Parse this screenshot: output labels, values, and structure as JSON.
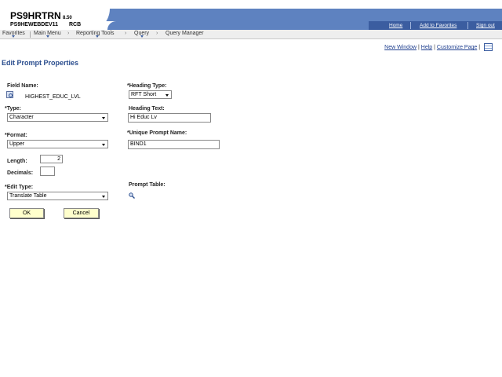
{
  "header": {
    "db_name": "PS9HRTRN",
    "db_version": "8.50",
    "server_name": "PS9HEWEBDEV11",
    "user_id": "RCB",
    "links": [
      "Home",
      "Add to Favorites",
      "Sign out"
    ]
  },
  "nav": {
    "favorites": "Favorites",
    "main_menu": "Main Menu",
    "reporting_tools": "Reporting Tools",
    "query": "Query",
    "query_manager": "Query Manager",
    "separator": "›"
  },
  "page_links": {
    "new_window": "New Window",
    "help": "Help",
    "customize_page": "Customize Page",
    "separator": "|"
  },
  "page": {
    "title": "Edit Prompt Properties"
  },
  "form": {
    "field_name_label": "Field Name:",
    "field_name_value": "HIGHEST_EDUC_LVL",
    "heading_type_label": "*Heading Type:",
    "heading_type_value": "RFT Short",
    "type_label": "*Type:",
    "type_value": "Character",
    "heading_text_label": "Heading Text:",
    "heading_text_value": "Hi Educ Lv",
    "format_label": "*Format:",
    "format_value": "Upper",
    "unique_prompt_label": "*Unique Prompt Name:",
    "unique_prompt_value": "BIND1",
    "length_label": "Length:",
    "length_value": "2",
    "decimals_label": "Decimals:",
    "decimals_value": "",
    "edit_type_label": "*Edit Type:",
    "edit_type_value": "Translate Table",
    "prompt_table_label": "Prompt Table:",
    "ok_label": "OK",
    "cancel_label": "Cancel"
  },
  "colors": {
    "banner": "#5e82c0",
    "banner_dark": "#3b5da0",
    "title": "#2a4d8e",
    "button_bg": "#ffffcc"
  }
}
